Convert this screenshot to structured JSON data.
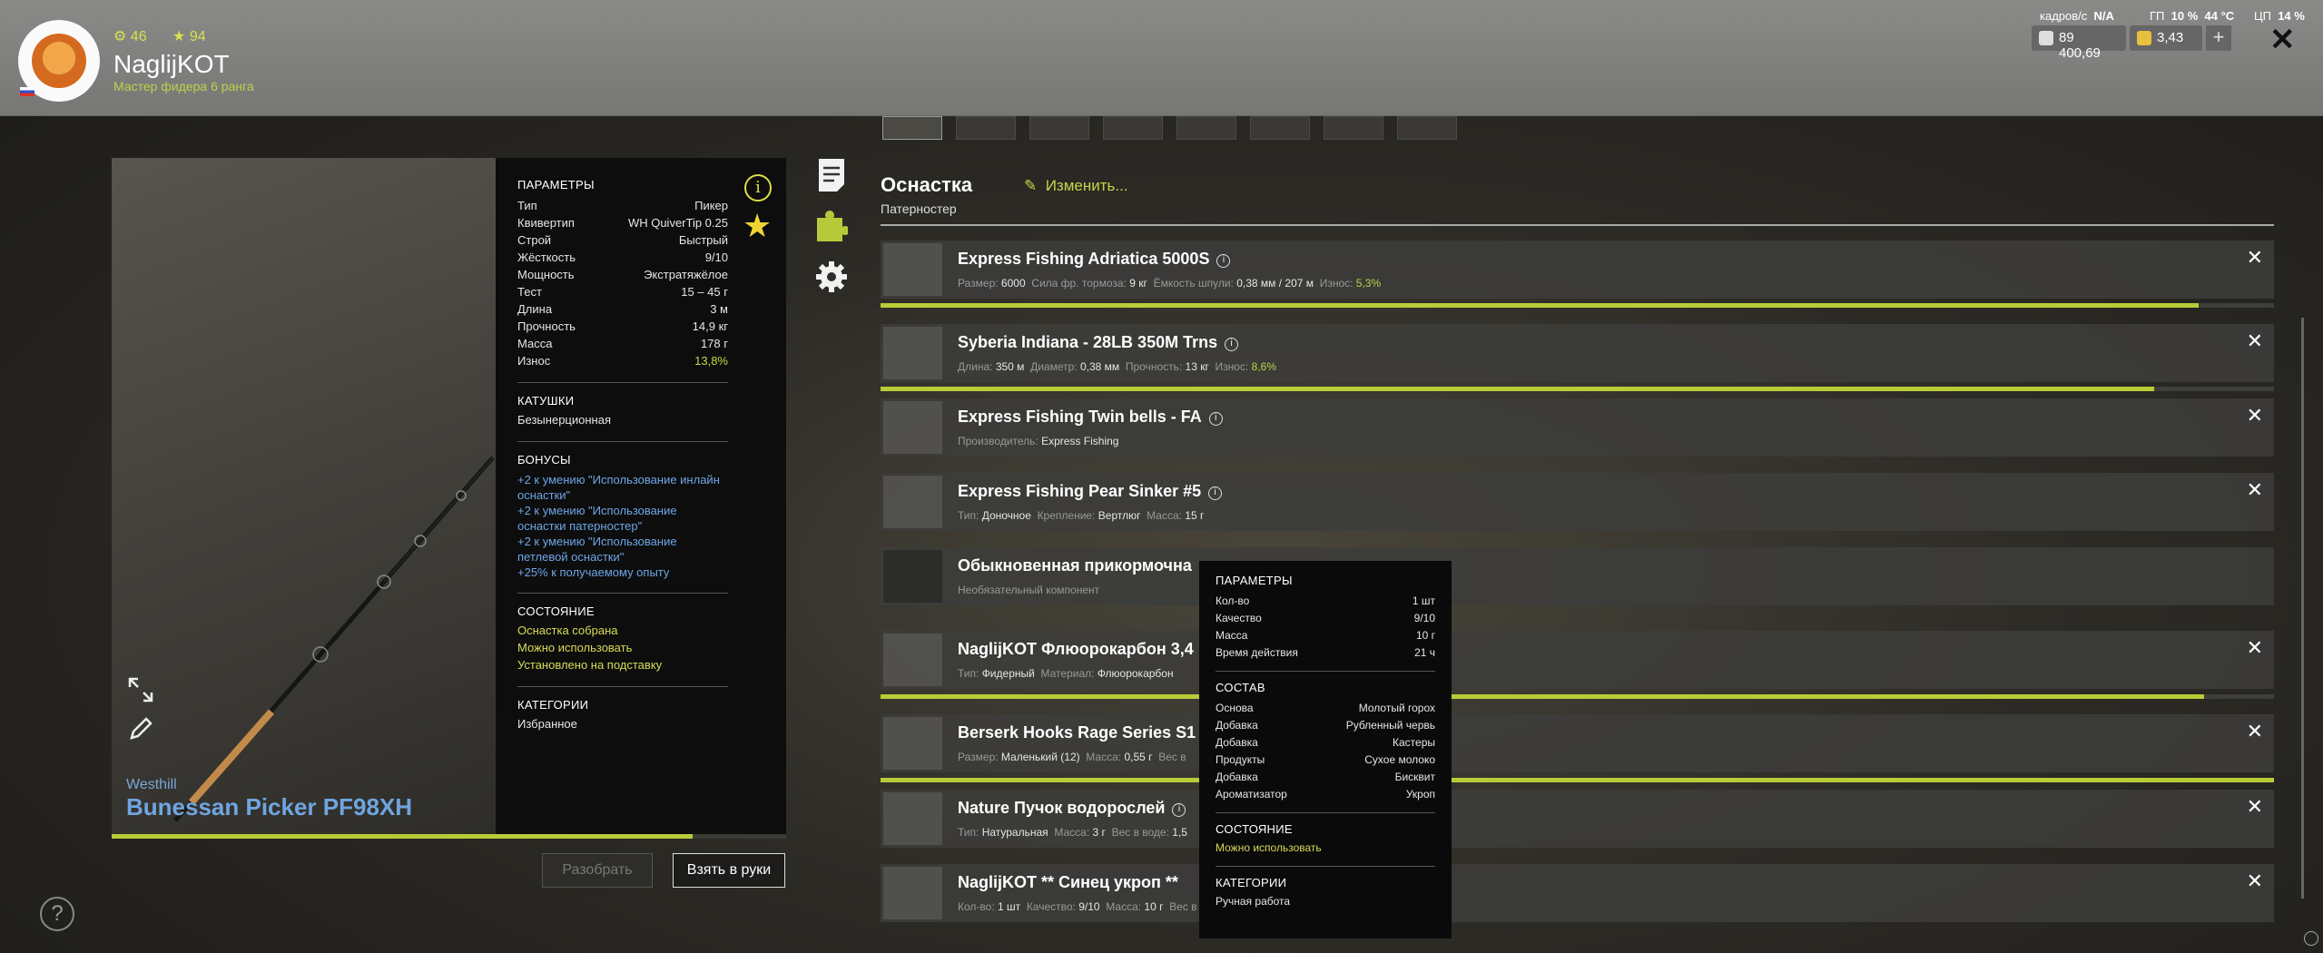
{
  "player": {
    "level_a": "46",
    "level_b": "94",
    "nick": "NaglijKOT",
    "rank": "Мастер фидера 6 ранга"
  },
  "stats": {
    "fps_label": "кадров/с",
    "fps_value": "N/A",
    "gpu_label": "ГП",
    "gpu_value": "10 %",
    "gpu_temp": "44 °C",
    "cpu_label": "ЦП",
    "cpu_value": "14 %"
  },
  "currency": {
    "silver": "89 400,69",
    "gold": "3,43",
    "plus": "+",
    "close": "✕"
  },
  "rod": {
    "brand": "Westhill",
    "name": "Bunessan Picker PF98XH",
    "wear_fraction": 0.862,
    "params_title": "ПАРАМЕТРЫ",
    "params": [
      {
        "k": "Тип",
        "v": "Пикер"
      },
      {
        "k": "Квивертип",
        "v": "WH QuiverTip 0.25"
      },
      {
        "k": "Строй",
        "v": "Быстрый"
      },
      {
        "k": "Жёсткость",
        "v": "9/10"
      },
      {
        "k": "Мощность",
        "v": "Экстратяжёлое"
      },
      {
        "k": "Тест",
        "v": "15 – 45 г"
      },
      {
        "k": "Длина",
        "v": "3 м"
      },
      {
        "k": "Прочность",
        "v": "14,9 кг"
      },
      {
        "k": "Масса",
        "v": "178 г"
      },
      {
        "k": "Износ",
        "v": "13,8%"
      }
    ],
    "reels_title": "КАТУШКИ",
    "reels_value": "Безынерционная",
    "bonus_title": "БОНУСЫ",
    "bonuses": [
      "+2 к умению \"Использование инлайн оснастки\"",
      "+2 к умению \"Использование оснастки патерностер\"",
      "+2 к умению \"Использование петлевой оснастки\"",
      "+25% к получаемому опыту"
    ],
    "state_title": "СОСТОЯНИЕ",
    "states": [
      "Оснастка собрана",
      "Можно использовать",
      "Установлено на подставку"
    ],
    "cat_title": "КАТЕГОРИИ",
    "cat_value": "Избранное",
    "btn_disassemble": "Разобрать",
    "btn_take": "Взять в руки",
    "help": "?"
  },
  "rig": {
    "title": "Оснастка",
    "change": "Изменить...",
    "subtitle": "Патерностер",
    "items": [
      {
        "name": "Express Fishing Adriatica 5000S",
        "details": [
          [
            "Размер:",
            "6000"
          ],
          [
            "Сила фр. тормоза:",
            "9 кг"
          ],
          [
            "Ёмкость шпули:",
            "0,38 мм / 207 м"
          ],
          [
            "Износ:",
            "5,3%"
          ]
        ],
        "wear": 0.946
      },
      {
        "name": "Syberia Indiana - 28LB 350M Trns",
        "details": [
          [
            "Длина:",
            "350 м"
          ],
          [
            "Диаметр:",
            "0,38 мм"
          ],
          [
            "Прочность:",
            "13 кг"
          ],
          [
            "Износ:",
            "8,6%"
          ]
        ],
        "wear": 0.914
      },
      {
        "name": "Express Fishing Twin bells - FA",
        "details": [
          [
            "Производитель:",
            "Express Fishing"
          ]
        ]
      },
      {
        "name": "Express Fishing Pear Sinker #5",
        "details": [
          [
            "Тип:",
            "Доночное"
          ],
          [
            "Крепление:",
            "Вертлюг"
          ],
          [
            "Масса:",
            "15 г"
          ]
        ]
      },
      {
        "name": "Обыкновенная прикормочна",
        "details": [
          [
            "Необязательный компонент",
            ""
          ]
        ]
      },
      {
        "name": "NaglijKOT Флюорокарбон 3,4",
        "details": [
          [
            "Тип:",
            "Фидерный"
          ],
          [
            "Материал:",
            "Флюорокарбон"
          ]
        ],
        "wear": 0.95
      },
      {
        "name": "Berserk Hooks Rage Series S1 S",
        "details": [
          [
            "Размер:",
            "Маленький (12)"
          ],
          [
            "Масса:",
            "0,55 г"
          ],
          [
            "Вес в",
            ""
          ]
        ],
        "wear": 1.0
      },
      {
        "name": "Nature Пучок водорослей",
        "details": [
          [
            "Тип:",
            "Натуральная"
          ],
          [
            "Масса:",
            "3 г"
          ],
          [
            "Вес в воде:",
            "1,5"
          ]
        ]
      },
      {
        "name": "NaglijKOT ** Синец укроп **",
        "details": [
          [
            "Кол-во:",
            "1 шт"
          ],
          [
            "Качество:",
            "9/10"
          ],
          [
            "Масса:",
            "10 г"
          ],
          [
            "Вес в",
            ""
          ]
        ]
      }
    ]
  },
  "tooltip": {
    "params_title": "ПАРАМЕТРЫ",
    "params": [
      {
        "k": "Кол-во",
        "v": "1 шт"
      },
      {
        "k": "Качество",
        "v": "9/10"
      },
      {
        "k": "Масса",
        "v": "10 г"
      },
      {
        "k": "Время действия",
        "v": "21 ч"
      }
    ],
    "comp_title": "СОСТАВ",
    "comp": [
      {
        "k": "Основа",
        "v": "Молотый горох"
      },
      {
        "k": "Добавка",
        "v": "Рубленный червь"
      },
      {
        "k": "Добавка",
        "v": "Кастеры"
      },
      {
        "k": "Продукты",
        "v": "Сухое молоко"
      },
      {
        "k": "Добавка",
        "v": "Бисквит"
      },
      {
        "k": "Ароматизатор",
        "v": "Укроп"
      }
    ],
    "state_title": "СОСТОЯНИЕ",
    "state": "Можно использовать",
    "cat_title": "КАТЕГОРИИ",
    "cat": "Ручная работа"
  }
}
